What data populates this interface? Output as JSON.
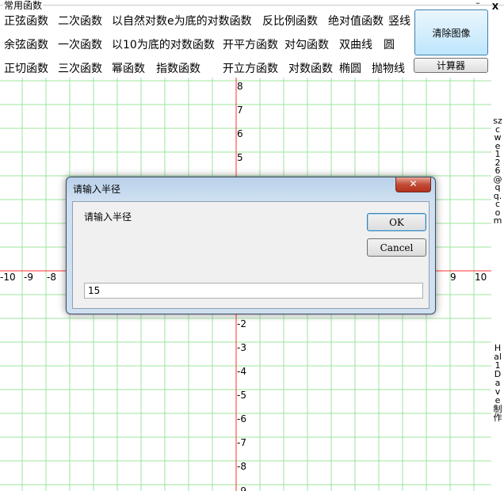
{
  "groupbox": {
    "title": "常用函数"
  },
  "functions": {
    "row1": [
      "正弦函数",
      "二次函数",
      "以自然对数e为底的对数函数",
      "反比例函数",
      "绝对值函数",
      "竖线"
    ],
    "row2": [
      "余弦函数",
      "一次函数",
      "以10为底的对数函数",
      "开平方函数",
      "对勾函数",
      "双曲线",
      "圆"
    ],
    "row3": [
      "正切函数",
      "三次函数",
      "幂函数",
      "指数函数",
      "开立方函数",
      "对数函数",
      "椭圆",
      "抛物线"
    ]
  },
  "buttons": {
    "clear": "清除图像",
    "calculator": "计算器"
  },
  "window": {
    "minimize": "–",
    "close": "X"
  },
  "side_text": {
    "email": "szcwe126@qq.com",
    "author": "Hal1Dave制作"
  },
  "graph": {
    "x_ticks": [
      "-10",
      "-9",
      "-8",
      "9",
      "10"
    ],
    "y_ticks": [
      "8",
      "7",
      "6",
      "5",
      "-2",
      "-3",
      "-4",
      "-5",
      "-6",
      "-7",
      "-8",
      "-9"
    ],
    "colors": {
      "grid": "#9ee59e",
      "axis": "#ff3030"
    }
  },
  "dialog": {
    "title": "请输入半径",
    "prompt": "请输入半径",
    "ok": "OK",
    "cancel": "Cancel",
    "input_value": "15"
  }
}
